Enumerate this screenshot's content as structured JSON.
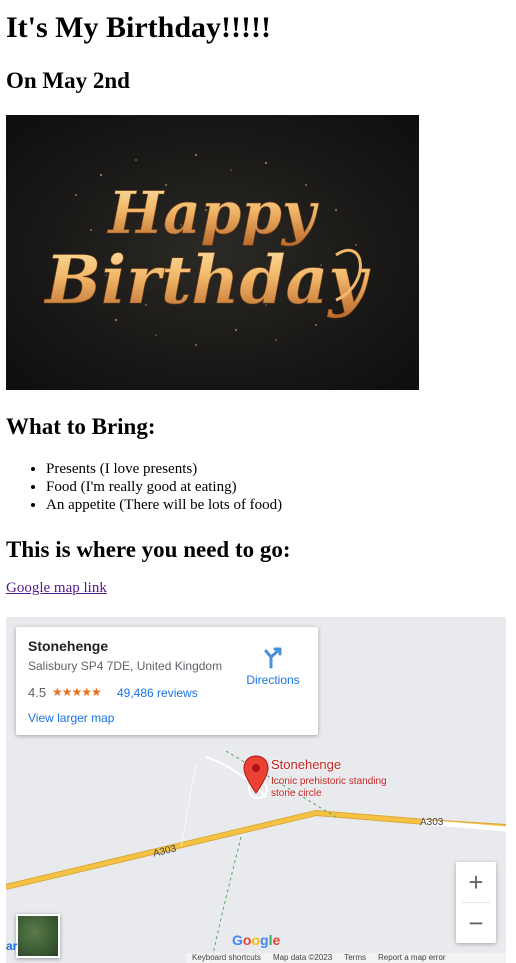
{
  "heading": "It's My Birthday!!!!!",
  "date": "On May 2nd",
  "banner": {
    "line1": "Happy",
    "line2": "Birthday"
  },
  "bring": {
    "title": "What to Bring:",
    "items": [
      "Presents (I love presents)",
      "Food (I'm really good at eating)",
      "An appetite (There will be lots of food)"
    ]
  },
  "go": {
    "title": "This is where you need to go:",
    "link_label": "Google map link"
  },
  "map": {
    "place": "Stonehenge",
    "address": "Salisbury SP4 7DE, United Kingdom",
    "rating": "4.5",
    "stars": "★★★★★",
    "rating_value": 4.5,
    "reviews": "49,486 reviews",
    "larger_map": "View larger map",
    "directions": "Directions",
    "pin_name": "Stonehenge",
    "pin_desc": "Iconic prehistoric standing stone circle",
    "road1": "A303",
    "road2": "A303",
    "zoom_in": "+",
    "zoom_out": "−",
    "ar_text": "ar",
    "logo": [
      "G",
      "o",
      "o",
      "g",
      "l",
      "e"
    ],
    "footer": [
      "Keyboard shortcuts",
      "Map data ©2023",
      "Terms",
      "Report a map error"
    ],
    "colors": {
      "link": "#1a73e8",
      "pin": "#ea4335",
      "stars": "#e7711b",
      "road": "#f6c243"
    }
  }
}
